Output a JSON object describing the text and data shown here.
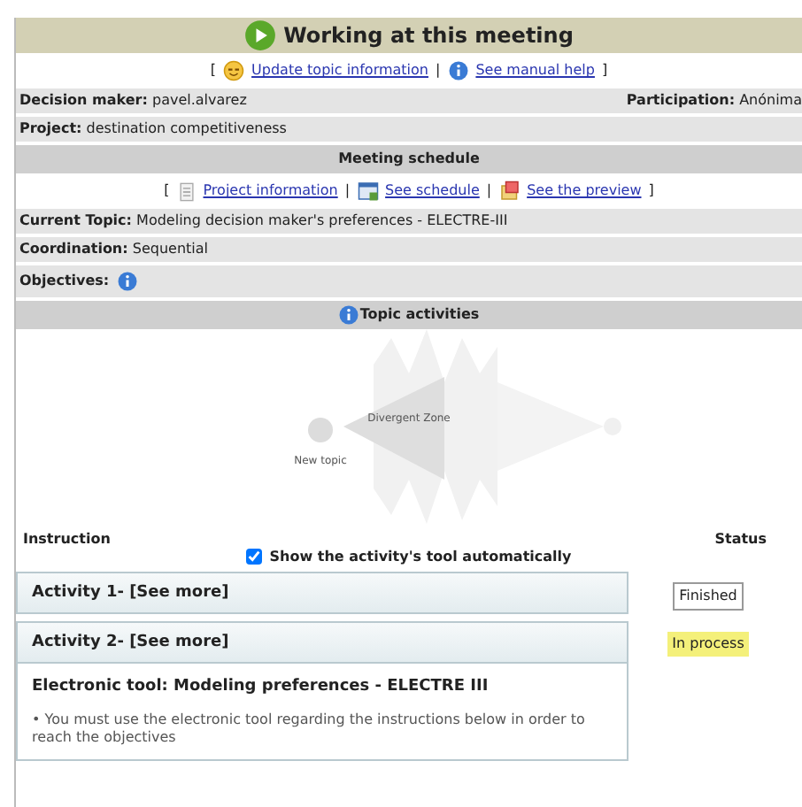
{
  "header": {
    "title": "Working at this meeting"
  },
  "top_links": {
    "open": "[",
    "separator": "|",
    "close": "]",
    "items": [
      {
        "label": "Update topic information",
        "kind": "smiley"
      },
      {
        "label": "See manual help",
        "kind": "info"
      }
    ]
  },
  "meeting": {
    "decision_maker": {
      "label": "Decision maker:",
      "value": "pavel.alvarez"
    },
    "participation": {
      "label": "Participation:",
      "value": "Anónima"
    },
    "project": {
      "label": "Project:",
      "value": "destination competitiveness"
    }
  },
  "schedule": {
    "title": "Meeting schedule",
    "open": "[",
    "separator": "|",
    "close": "]",
    "links": [
      {
        "label": "Project information",
        "kind": "document"
      },
      {
        "label": "See schedule",
        "kind": "calendar"
      },
      {
        "label": "See the preview",
        "kind": "preview"
      }
    ]
  },
  "topic": {
    "current": {
      "label": "Current Topic:",
      "value": "Modeling decision maker's preferences - ELECTRE-III"
    },
    "coordination": {
      "label": "Coordination:",
      "value": "Sequential"
    },
    "objectives": {
      "label": "Objectives:"
    }
  },
  "activities_section": {
    "title": "Topic activities",
    "diagram": {
      "start_label": "New topic",
      "zone_label": "Divergent Zone"
    },
    "instruction_header": "Instruction",
    "status_header": "Status",
    "auto_show": {
      "label": "Show the activity's tool automatically",
      "checked": true
    }
  },
  "activities": [
    {
      "title": "Activity 1- [See more]",
      "status": "Finished",
      "kind": "finished",
      "expanded": false
    },
    {
      "title": "Activity 2- [See more]",
      "status": "In process",
      "kind": "in_process",
      "expanded": true,
      "tool": "Electronic tool: Modeling preferences - ELECTRE III",
      "bullet": "•",
      "instruction": "You must use the electronic tool regarding the instructions below in order to reach the objectives"
    }
  ]
}
